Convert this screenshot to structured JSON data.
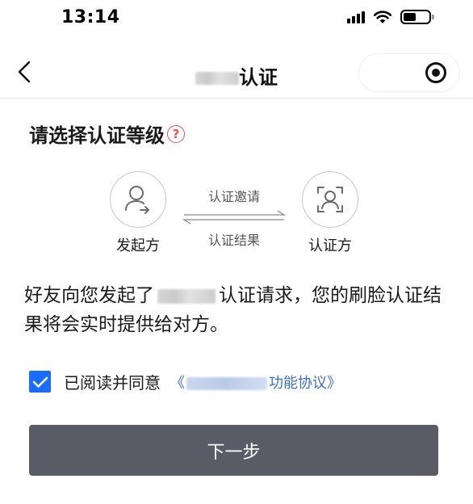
{
  "status": {
    "time": "13:14",
    "icons": [
      "signal-icon",
      "wifi-icon",
      "battery-icon"
    ]
  },
  "nav": {
    "title_suffix": "认证",
    "back_icon": "chevron-left-icon",
    "capsule_icon": "record-icon"
  },
  "section": {
    "title": "请选择认证等级",
    "help_icon": "?"
  },
  "flow": {
    "initiator_label": "发起方",
    "verifier_label": "认证方",
    "invite_label": "认证邀请",
    "result_label": "认证结果"
  },
  "description": {
    "prefix": "好友向您发起了",
    "suffix": "认证请求，您的刷脸认证结果将会实时提供给对方。"
  },
  "agreement": {
    "checked": true,
    "text": "已阅读并同意",
    "link_open": "《",
    "link_tail": "功能协议》"
  },
  "button": {
    "label": "下一步"
  },
  "colors": {
    "accent": "#1a6cff",
    "link": "#3b6ec9",
    "button": "#595c66",
    "help": "#ef4f4f"
  }
}
